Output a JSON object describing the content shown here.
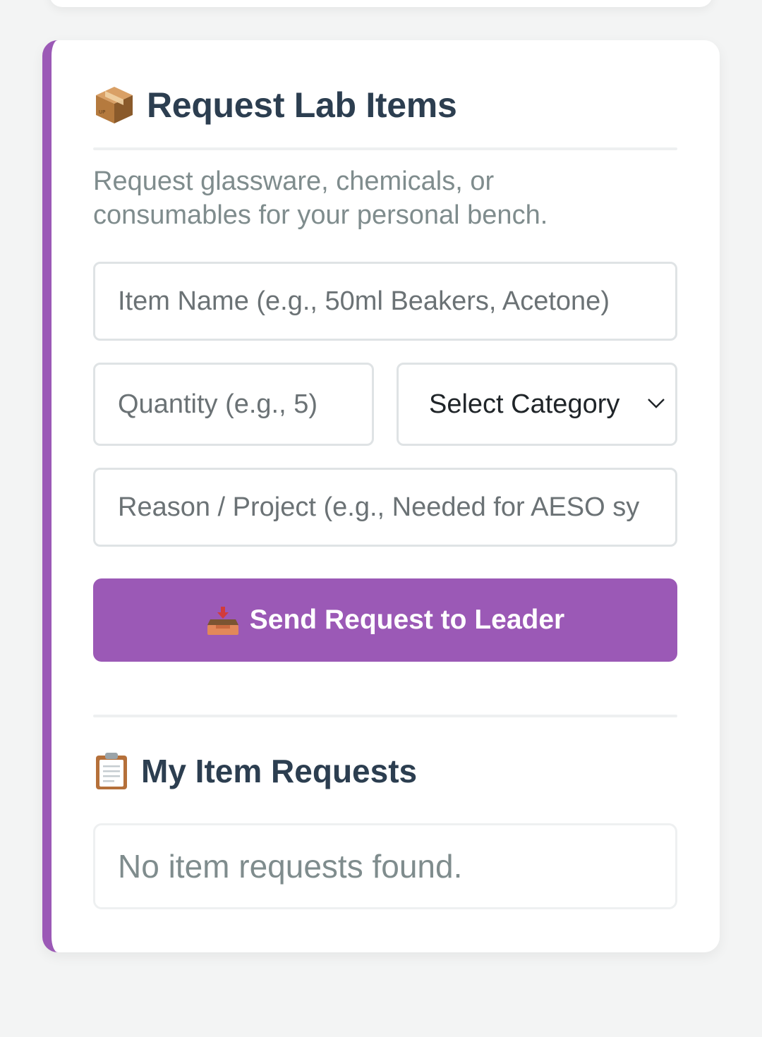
{
  "request_section": {
    "title": "Request Lab Items",
    "title_icon": "package-icon",
    "subtitle_line1": "Request glassware, chemicals, or",
    "subtitle_line2": "consumables for your personal bench.",
    "item_name_placeholder": "Item Name (e.g., 50ml Beakers, Acetone)",
    "quantity_placeholder": "Quantity (e.g., 5)",
    "category_selected": "Select Category",
    "reason_placeholder": "Reason / Project (e.g., Needed for AESO sy",
    "submit_label": "Send Request to Leader",
    "submit_icon": "inbox-tray-icon"
  },
  "my_requests": {
    "title": "My Item Requests",
    "title_icon": "clipboard-icon",
    "empty_message": "No item requests found."
  },
  "colors": {
    "accent": "#9b59b6",
    "heading": "#2c3e50",
    "muted": "#7f8c8d"
  }
}
